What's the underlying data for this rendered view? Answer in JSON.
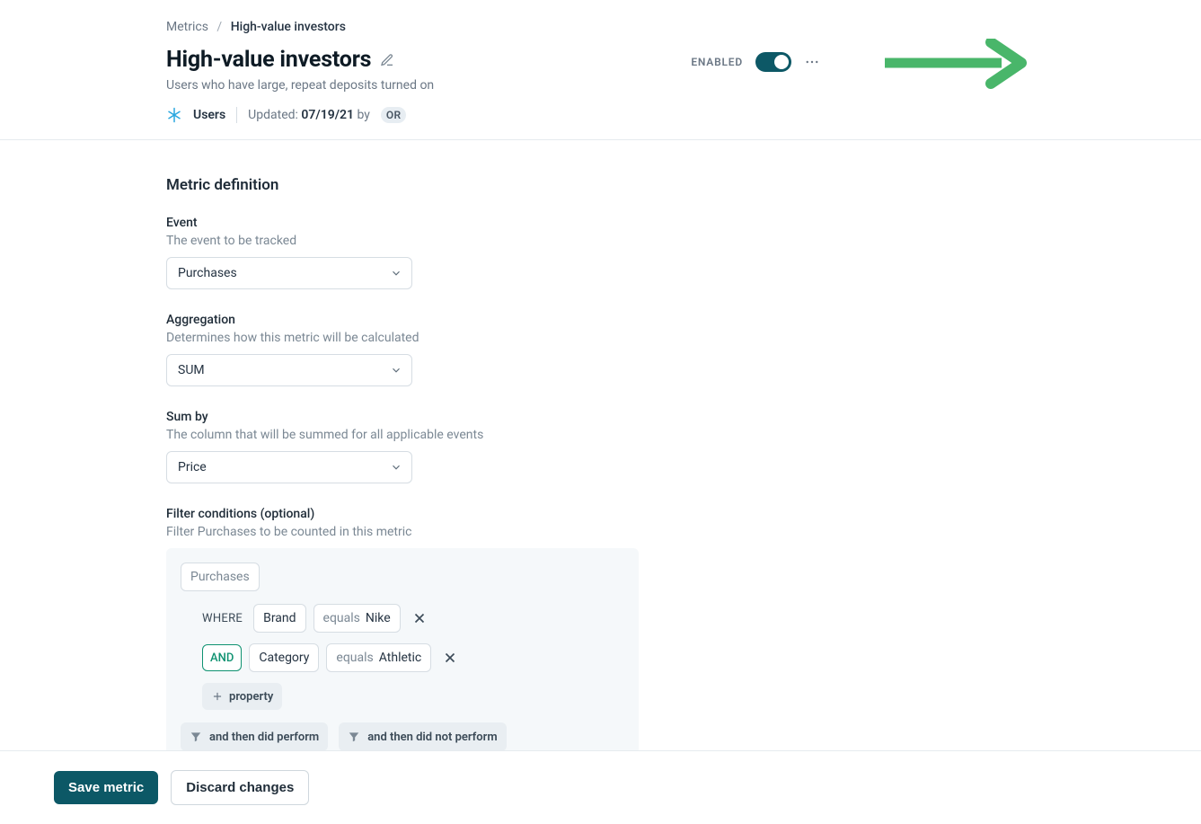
{
  "breadcrumb": {
    "root": "Metrics",
    "current": "High-value investors"
  },
  "title": "High-value investors",
  "subtitle": "Users who have large, repeat deposits turned on",
  "meta": {
    "source": "Users",
    "updated_prefix": "Updated: ",
    "updated_date": "07/19/21",
    "updated_by": " by ",
    "author_initials": "OR"
  },
  "enabled_label": "ENABLED",
  "section_title": "Metric definition",
  "event": {
    "label": "Event",
    "help": "The event to be tracked",
    "value": "Purchases"
  },
  "aggregation": {
    "label": "Aggregation",
    "help": "Determines how this metric will be calculated",
    "value": "SUM"
  },
  "sum_by": {
    "label": "Sum by",
    "help": "The column that will be summed for all applicable events",
    "value": "Price"
  },
  "filters": {
    "label": "Filter conditions (optional)",
    "help": "Filter Purchases to be counted in this metric",
    "source": "Purchases",
    "where_label": "WHERE",
    "and_label": "AND",
    "rows": [
      {
        "field": "Brand",
        "op": "equals",
        "value": "Nike"
      },
      {
        "field": "Category",
        "op": "equals",
        "value": "Athletic"
      }
    ],
    "add_property": "property",
    "then_perform": "and then did perform",
    "then_not_perform": "and then did not perform"
  },
  "actions": {
    "save": "Save metric",
    "discard": "Discard changes"
  }
}
